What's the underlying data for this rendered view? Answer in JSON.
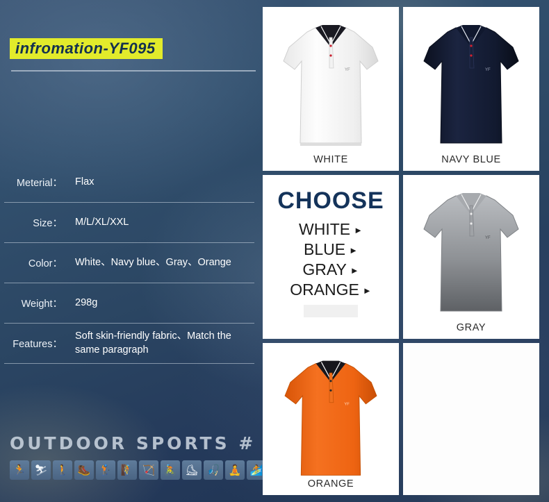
{
  "title": "infromation-YF095",
  "specs": [
    {
      "label": "Meterial：",
      "value": "Flax"
    },
    {
      "label": "Size：",
      "value": "M/L/XL/XXL"
    },
    {
      "label": "Color：",
      "value": "White、Navy blue、Gray、Orange"
    },
    {
      "label": "Weight：",
      "value": "298g"
    },
    {
      "label": "Features：",
      "value": "Soft skin-friendly fabric、Match the same paragraph"
    }
  ],
  "outdoor": {
    "heading": "OUTDOOR SPORTS #",
    "icons": [
      "runner-icon",
      "skier-icon",
      "walker-icon",
      "hiker-icon",
      "golfer-icon",
      "climber-icon",
      "archer-icon",
      "cyclist-icon",
      "skater-icon",
      "fisher-icon",
      "yoga-icon",
      "surfer-icon"
    ],
    "glyphs": [
      "🏃",
      "⛷",
      "🚶",
      "🥾",
      "🏌",
      "🧗",
      "🏹",
      "🚴",
      "⛸",
      "🎣",
      "🧘",
      "🏄"
    ]
  },
  "gallery": [
    {
      "name": "white-polo",
      "caption": "WHITE",
      "color": "#f4f4f4"
    },
    {
      "name": "navy-polo",
      "caption": "NAVY BLUE",
      "color": "#12182c"
    },
    {
      "name": "choose-panel",
      "caption": ""
    },
    {
      "name": "gray-polo",
      "caption": "GRAY",
      "color": "#8a8d91"
    },
    {
      "name": "orange-polo",
      "caption": "ORANGE",
      "color": "#f0681c"
    },
    {
      "name": "empty-cell",
      "caption": ""
    }
  ],
  "choose": {
    "heading": "CHOOSE",
    "options": [
      "WHITE",
      "BLUE",
      "GRAY",
      "ORANGE"
    ],
    "arrow": "►"
  },
  "colors": {
    "accent": "#e2eb2b",
    "title_text": "#13304f",
    "background": "#2b4663"
  }
}
